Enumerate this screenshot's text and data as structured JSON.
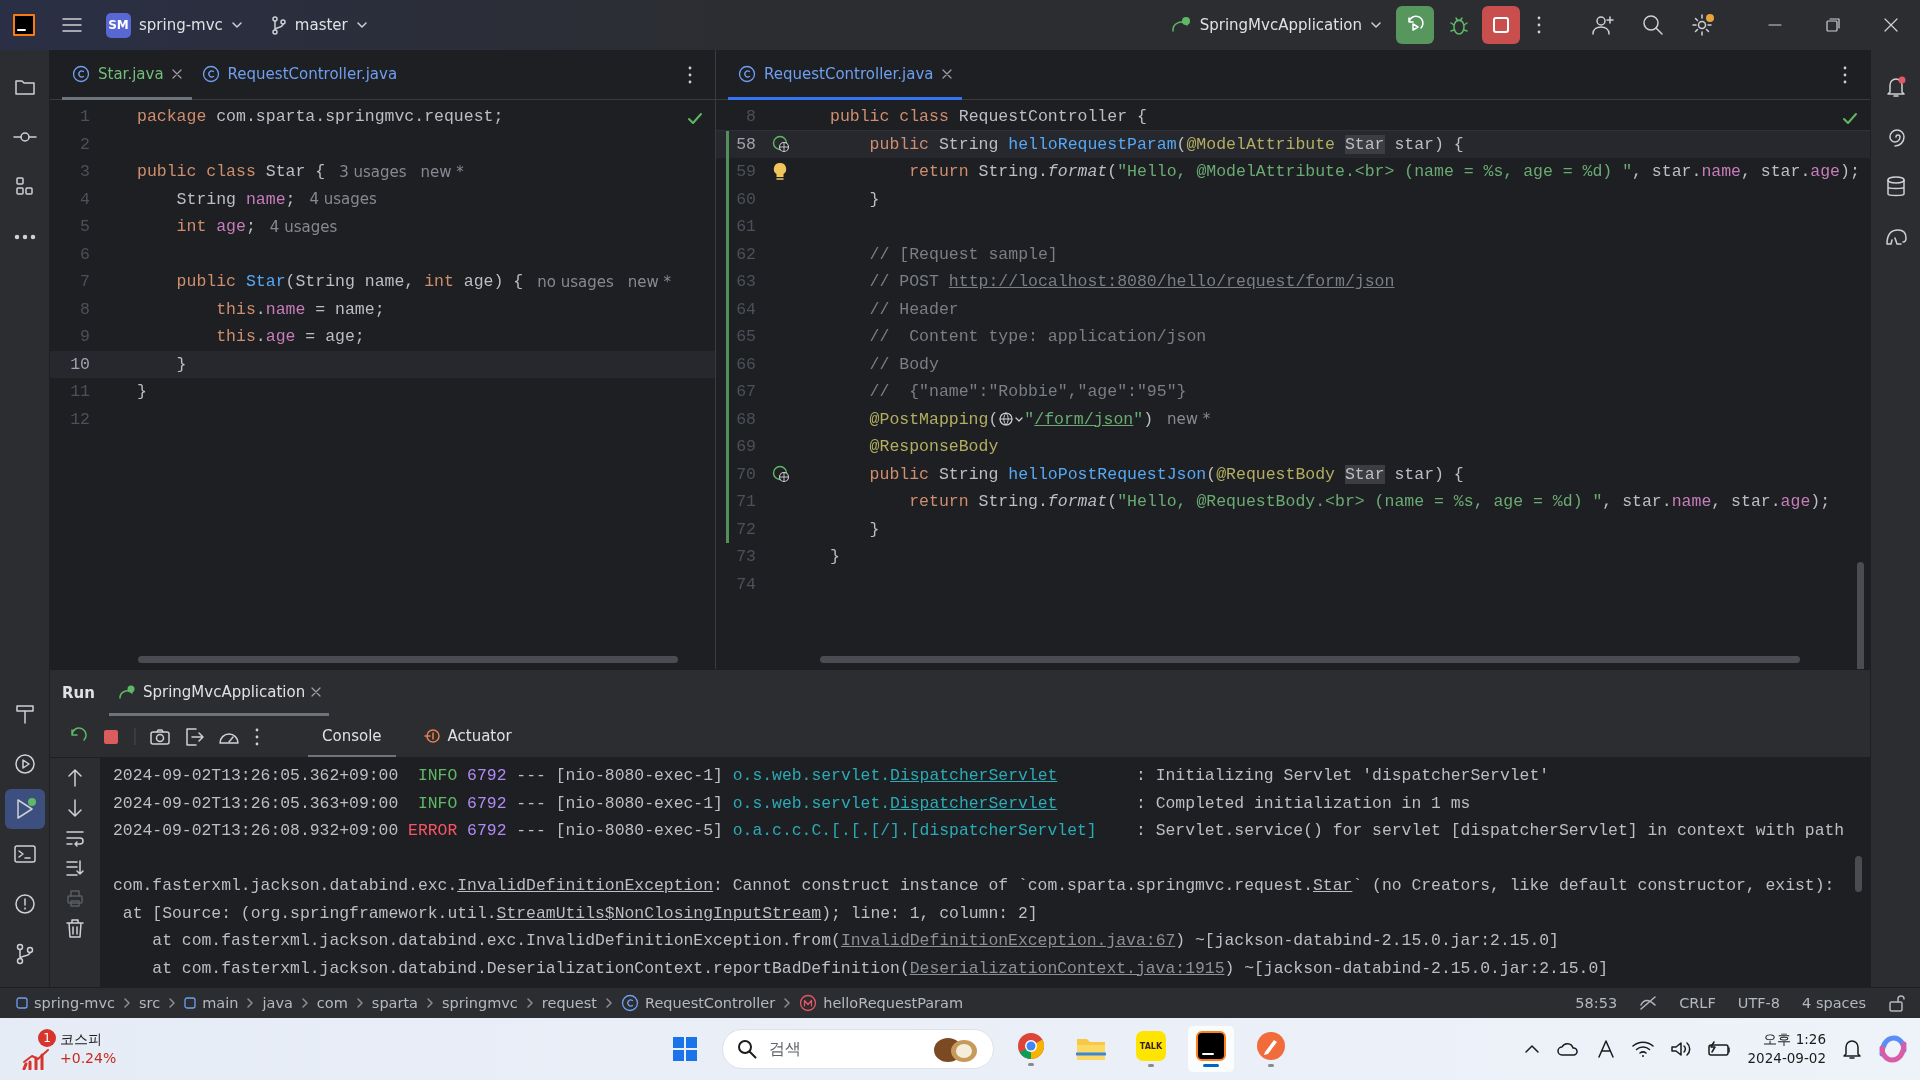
{
  "titlebar": {
    "project_badge": "SM",
    "project": "spring-mvc",
    "branch": "master",
    "run_config": "SpringMvcApplication"
  },
  "left_editor": {
    "tabs": [
      {
        "label": "Star.java",
        "selected": true,
        "color": "#73bd79"
      },
      {
        "label": "RequestController.java",
        "selected": false,
        "color": "#6f9ff0"
      }
    ],
    "lines": [
      {
        "number": "1",
        "current": false,
        "tokens": [
          {
            "text": "package ",
            "kind": "kw"
          },
          {
            "text": "com.sparta.springmvc.request;",
            "kind": "pl"
          }
        ]
      },
      {
        "number": "2",
        "current": false
      },
      {
        "number": "3",
        "current": false,
        "tokens": [
          {
            "text": "public class ",
            "kind": "kw"
          },
          {
            "text": "Star {",
            "kind": "pl"
          }
        ],
        "hints": [
          "3 usages",
          "new *"
        ]
      },
      {
        "number": "4",
        "current": false,
        "tokens": [
          {
            "text": "    String ",
            "kind": "pl"
          },
          {
            "text": "name",
            "kind": "fd"
          },
          {
            "text": ";",
            "kind": "pl"
          }
        ],
        "hints": [
          "4 usages"
        ]
      },
      {
        "number": "5",
        "current": false,
        "tokens": [
          {
            "text": "    int ",
            "kind": "kw"
          },
          {
            "text": "age",
            "kind": "fd"
          },
          {
            "text": ";",
            "kind": "pl"
          }
        ],
        "hints": [
          "4 usages"
        ]
      },
      {
        "number": "6",
        "current": false
      },
      {
        "number": "7",
        "current": false,
        "tokens": [
          {
            "text": "    public ",
            "kind": "kw"
          },
          {
            "text": "Star",
            "kind": "fn"
          },
          {
            "text": "(String name, ",
            "kind": "pl"
          },
          {
            "text": "int ",
            "kind": "kw"
          },
          {
            "text": "age) {",
            "kind": "pl"
          }
        ],
        "hints": [
          "no usages",
          "new *"
        ]
      },
      {
        "number": "8",
        "current": false,
        "tokens": [
          {
            "text": "        this",
            "kind": "kw"
          },
          {
            "text": ".",
            "kind": "pl"
          },
          {
            "text": "name",
            "kind": "fd"
          },
          {
            "text": " = name;",
            "kind": "pl"
          }
        ]
      },
      {
        "number": "9",
        "current": false,
        "tokens": [
          {
            "text": "        this",
            "kind": "kw"
          },
          {
            "text": ".",
            "kind": "pl"
          },
          {
            "text": "age",
            "kind": "fd"
          },
          {
            "text": " = age;",
            "kind": "pl"
          }
        ]
      },
      {
        "number": "10",
        "current": true,
        "tokens": [
          {
            "text": "    }",
            "kind": "pl"
          }
        ]
      },
      {
        "number": "11",
        "current": false,
        "tokens": [
          {
            "text": "}",
            "kind": "pl"
          }
        ]
      },
      {
        "number": "12",
        "current": false
      }
    ]
  },
  "right_editor": {
    "tabs": [
      {
        "label": "RequestController.java",
        "selected": true,
        "color": "#6f9ff0"
      }
    ],
    "sticky_line": {
      "number": "8",
      "tokens": [
        {
          "text": "public class ",
          "kind": "kw"
        },
        {
          "text": "RequestController {",
          "kind": "pl"
        }
      ]
    },
    "lines": [
      {
        "number": "58",
        "current": true,
        "changed": true,
        "kind": "endpoint",
        "tokens": [
          {
            "text": "    public ",
            "kind": "kw"
          },
          {
            "text": "String ",
            "kind": "pl"
          },
          {
            "text": "helloRequestParam",
            "kind": "fn"
          },
          {
            "text": "(",
            "kind": "pl"
          },
          {
            "text": "@ModelAttribute ",
            "kind": "an"
          },
          {
            "text": "Star",
            "kind": "hl"
          },
          {
            "text": " star) {",
            "kind": "pl"
          }
        ]
      },
      {
        "number": "59",
        "current": false,
        "changed": true,
        "kind": "bulb",
        "tokens": [
          {
            "text": "        return ",
            "kind": "kw"
          },
          {
            "text": "String.",
            "kind": "pl"
          },
          {
            "text": "format",
            "kind": "it"
          },
          {
            "text": "(",
            "kind": "pl"
          },
          {
            "text": "\"Hello, @ModelAttribute.<br> (name = %s, age = %d) \"",
            "kind": "st"
          },
          {
            "text": ", star.",
            "kind": "pl"
          },
          {
            "text": "name",
            "kind": "fd"
          },
          {
            "text": ", star.",
            "kind": "pl"
          },
          {
            "text": "age",
            "kind": "fd"
          },
          {
            "text": ");",
            "kind": "pl"
          }
        ]
      },
      {
        "number": "60",
        "current": false,
        "changed": true,
        "tokens": [
          {
            "text": "    }",
            "kind": "pl"
          }
        ]
      },
      {
        "number": "61",
        "current": false,
        "changed": true
      },
      {
        "number": "62",
        "current": false,
        "changed": true,
        "tokens": [
          {
            "text": "    // [Request sample]",
            "kind": "cm"
          }
        ]
      },
      {
        "number": "63",
        "current": false,
        "changed": true,
        "tokens": [
          {
            "text": "    // POST ",
            "kind": "cm"
          },
          {
            "text": "http://localhost:8080/hello/request/form/json",
            "kind": "cl"
          }
        ]
      },
      {
        "number": "64",
        "current": false,
        "changed": true,
        "tokens": [
          {
            "text": "    // Header",
            "kind": "cm"
          }
        ]
      },
      {
        "number": "65",
        "current": false,
        "changed": true,
        "tokens": [
          {
            "text": "    //  Content type: application/json",
            "kind": "cm"
          }
        ]
      },
      {
        "number": "66",
        "current": false,
        "changed": true,
        "tokens": [
          {
            "text": "    // Body",
            "kind": "cm"
          }
        ]
      },
      {
        "number": "67",
        "current": false,
        "changed": true,
        "tokens": [
          {
            "text": "    //  {\"name\":\"Robbie\",\"age\":\"95\"}",
            "kind": "cm"
          }
        ]
      },
      {
        "number": "68",
        "current": false,
        "changed": true,
        "tokens": [
          {
            "text": "    @PostMapping",
            "kind": "an"
          },
          {
            "text": "(",
            "kind": "pl"
          },
          {
            "kind": "globe"
          },
          {
            "text": "\"",
            "kind": "st"
          },
          {
            "text": "/form/json",
            "kind": "sl"
          },
          {
            "text": "\"",
            "kind": "st"
          },
          {
            "text": ")",
            "kind": "pl"
          }
        ],
        "hints": [
          "new *"
        ]
      },
      {
        "number": "69",
        "current": false,
        "changed": true,
        "tokens": [
          {
            "text": "    @ResponseBody",
            "kind": "an"
          }
        ]
      },
      {
        "number": "70",
        "current": false,
        "changed": true,
        "kind": "endpoint",
        "tokens": [
          {
            "text": "    public ",
            "kind": "kw"
          },
          {
            "text": "String ",
            "kind": "pl"
          },
          {
            "text": "helloPostRequestJson",
            "kind": "fn"
          },
          {
            "text": "(",
            "kind": "pl"
          },
          {
            "text": "@RequestBody ",
            "kind": "an"
          },
          {
            "text": "Star",
            "kind": "hl"
          },
          {
            "text": " star) {",
            "kind": "pl"
          }
        ]
      },
      {
        "number": "71",
        "current": false,
        "changed": true,
        "tokens": [
          {
            "text": "        return ",
            "kind": "kw"
          },
          {
            "text": "String.",
            "kind": "pl"
          },
          {
            "text": "format",
            "kind": "it"
          },
          {
            "text": "(",
            "kind": "pl"
          },
          {
            "text": "\"Hello, @RequestBody.<br> (name = %s, age = %d) \"",
            "kind": "st"
          },
          {
            "text": ", star.",
            "kind": "pl"
          },
          {
            "text": "name",
            "kind": "fd"
          },
          {
            "text": ", star.",
            "kind": "pl"
          },
          {
            "text": "age",
            "kind": "fd"
          },
          {
            "text": ");",
            "kind": "pl"
          }
        ]
      },
      {
        "number": "72",
        "current": false,
        "changed": true,
        "tokens": [
          {
            "text": "    }",
            "kind": "pl"
          }
        ]
      },
      {
        "number": "73",
        "current": false,
        "changed": false,
        "tokens": [
          {
            "text": "}",
            "kind": "pl"
          }
        ]
      },
      {
        "number": "74",
        "current": false,
        "changed": false
      }
    ]
  },
  "run_panel": {
    "title": "Run",
    "tabs": [
      {
        "label": "SpringMvcApplication",
        "selected": true
      }
    ],
    "subtabs": [
      {
        "label": "Console",
        "selected": true,
        "kind": "plain"
      },
      {
        "label": "Actuator",
        "selected": false,
        "kind": "actuator"
      }
    ],
    "console_lines": [
      {
        "kind": "log",
        "tokens": [
          {
            "text": "2024-09-02T13:26:05.362+09:00  ",
            "kind": "pl"
          },
          {
            "text": "INFO",
            "kind": "ok"
          },
          {
            "text": " 6792",
            "kind": "pid"
          },
          {
            "text": " --- [nio-8080-exec-1] ",
            "kind": "pl"
          },
          {
            "text": "o.s.web.servlet.",
            "kind": "lg"
          },
          {
            "text": "DispatcherServlet",
            "kind": "lgl"
          },
          {
            "text": "        : Initializing Servlet 'dispatcherServlet'",
            "kind": "pl"
          }
        ]
      },
      {
        "kind": "log",
        "tokens": [
          {
            "text": "2024-09-02T13:26:05.363+09:00  ",
            "kind": "pl"
          },
          {
            "text": "INFO",
            "kind": "ok"
          },
          {
            "text": " 6792",
            "kind": "pid"
          },
          {
            "text": " --- [nio-8080-exec-1] ",
            "kind": "pl"
          },
          {
            "text": "o.s.web.servlet.",
            "kind": "lg"
          },
          {
            "text": "DispatcherServlet",
            "kind": "lgl"
          },
          {
            "text": "        : Completed initialization in 1 ms",
            "kind": "pl"
          }
        ]
      },
      {
        "kind": "log",
        "tokens": [
          {
            "text": "2024-09-02T13:26:08.932+09:00 ",
            "kind": "pl"
          },
          {
            "text": "ERROR",
            "kind": "er"
          },
          {
            "text": " 6792",
            "kind": "pid"
          },
          {
            "text": " --- [nio-8080-exec-5] ",
            "kind": "pl"
          },
          {
            "text": "o.a.c.c.C.[.[.[/].[dispatcherServlet]",
            "kind": "lg"
          },
          {
            "text": "    : Servlet.service() for servlet [dispatcherServlet] in context with path",
            "kind": "pl"
          }
        ]
      },
      {
        "kind": "exception",
        "tokens": [
          {
            "text": "com.fasterxml.jackson.databind.exc.",
            "kind": "pl"
          },
          {
            "text": "InvalidDefinitionException",
            "kind": "ul"
          },
          {
            "text": ": Cannot construct instance of `com.sparta.springmvc.request.",
            "kind": "pl"
          },
          {
            "text": "Star",
            "kind": "ul"
          },
          {
            "text": "` (no Creators, like default constructor, exist):",
            "kind": "pl"
          }
        ]
      },
      {
        "kind": "trace",
        "tokens": [
          {
            "text": " at [Source: (org.springframework.util.",
            "kind": "pl"
          },
          {
            "text": "StreamUtils$NonClosingInputStream",
            "kind": "ul"
          },
          {
            "text": "); line: 1, column: 2]",
            "kind": "pl"
          }
        ]
      },
      {
        "kind": "trace",
        "tokens": [
          {
            "text": "    at com.fasterxml.jackson.databind.exc.InvalidDefinitionException.from(",
            "kind": "pl"
          },
          {
            "text": "InvalidDefinitionException.java:67",
            "kind": "lk"
          },
          {
            "text": ") ~[jackson-databind-2.15.0.jar:2.15.0]",
            "kind": "pl"
          }
        ]
      },
      {
        "kind": "trace",
        "tokens": [
          {
            "text": "    at com.fasterxml.jackson.databind.DeserializationContext.reportBadDefinition(",
            "kind": "pl"
          },
          {
            "text": "DeserializationContext.java:1915",
            "kind": "lk"
          },
          {
            "text": ") ~[jackson-databind-2.15.0.jar:2.15.0]",
            "kind": "pl"
          }
        ]
      }
    ]
  },
  "status_bar": {
    "breadcrumbs": [
      {
        "label": "spring-mvc",
        "kind": "module"
      },
      {
        "label": "src",
        "kind": "folder"
      },
      {
        "label": "main",
        "kind": "module"
      },
      {
        "label": "java",
        "kind": "folder"
      },
      {
        "label": "com",
        "kind": "folder"
      },
      {
        "label": "sparta",
        "kind": "folder"
      },
      {
        "label": "springmvc",
        "kind": "folder"
      },
      {
        "label": "request",
        "kind": "folder"
      },
      {
        "label": "RequestController",
        "kind": "class"
      },
      {
        "label": "helloRequestParam",
        "kind": "method"
      }
    ],
    "position": "58:53",
    "line_ending": "CRLF",
    "encoding": "UTF-8",
    "indent": "4 spaces"
  },
  "taskbar": {
    "widget_badge": "1",
    "widget_title": "코스피",
    "widget_value": "+0.24%",
    "search_placeholder": "검색",
    "kakao_label": "TALK",
    "clock_time": "오후 1:26",
    "clock_date": "2024-09-02"
  }
}
